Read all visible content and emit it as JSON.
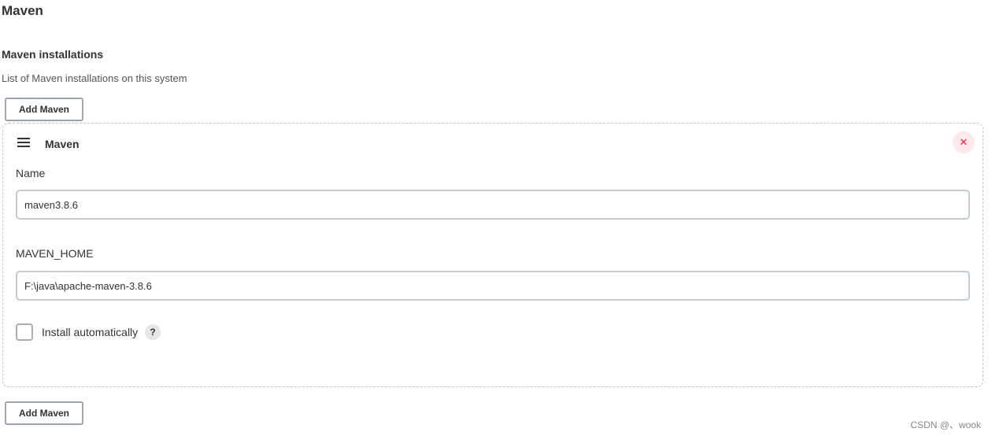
{
  "section": {
    "title": "Maven"
  },
  "installations": {
    "label": "Maven installations",
    "description": "List of Maven installations on this system",
    "add_button_label": "Add Maven"
  },
  "card": {
    "title": "Maven",
    "delete_symbol": "✕",
    "name_label": "Name",
    "name_value": "maven3.8.6",
    "home_label": "MAVEN_HOME",
    "home_value": "F:\\java\\apache-maven-3.8.6",
    "install_auto_label": "Install automatically",
    "install_auto_checked": false,
    "help_symbol": "?"
  },
  "watermark": {
    "text": "CSDN @、wook"
  }
}
